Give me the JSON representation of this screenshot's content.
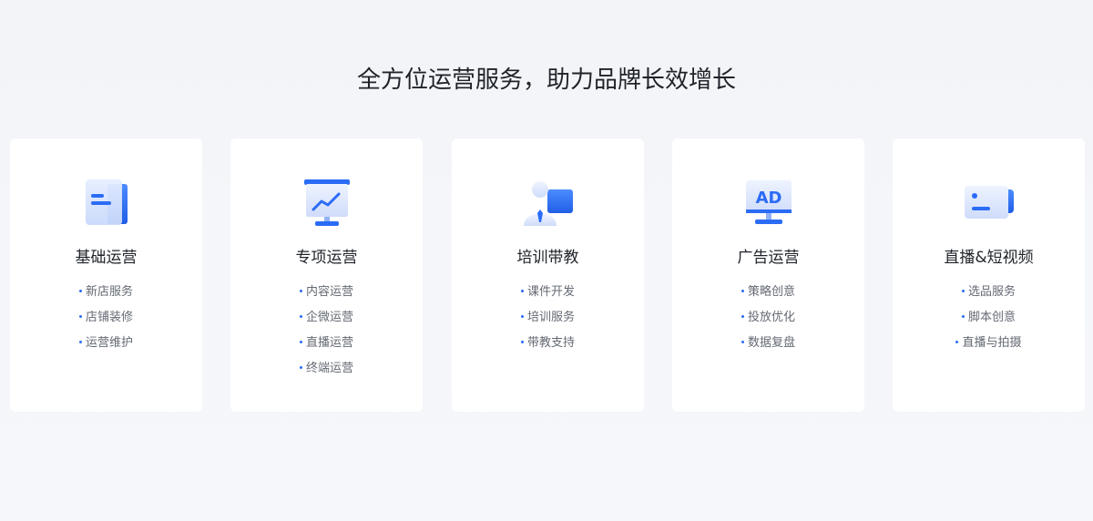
{
  "page": {
    "title": "全方位运营服务，助力品牌长效增长"
  },
  "colors": {
    "accent": "#2b6cf6",
    "card_background": "#ffffff",
    "page_background": "#f3f5f9",
    "title_text": "#1f2329",
    "item_text": "#646a73"
  },
  "services": [
    {
      "icon": "document-icon",
      "title": "基础运营",
      "items": [
        "新店服务",
        "店铺装修",
        "运营维护"
      ]
    },
    {
      "icon": "trend-chart-icon",
      "title": "专项运营",
      "items": [
        "内容运营",
        "企微运营",
        "直播运营",
        "终端运营"
      ]
    },
    {
      "icon": "trainer-icon",
      "title": "培训带教",
      "items": [
        "课件开发",
        "培训服务",
        "带教支持"
      ]
    },
    {
      "icon": "ad-monitor-icon",
      "title": "广告运营",
      "items": [
        "策略创意",
        "投放优化",
        "数据复盘"
      ]
    },
    {
      "icon": "video-camera-icon",
      "title": "直播&短视频",
      "items": [
        "选品服务",
        "脚本创意",
        "直播与拍摄"
      ]
    }
  ]
}
